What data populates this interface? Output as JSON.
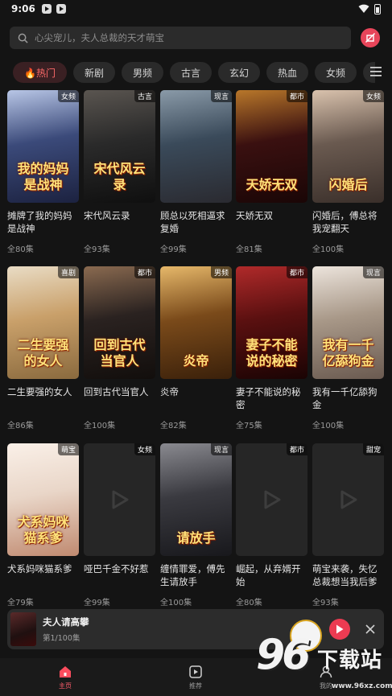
{
  "status_bar": {
    "time": "9:06"
  },
  "search": {
    "placeholder": "心尖宠儿，夫人总裁的天才萌宝"
  },
  "tabs": [
    {
      "label": "🔥热门",
      "active": true
    },
    {
      "label": "新剧"
    },
    {
      "label": "男频"
    },
    {
      "label": "古言"
    },
    {
      "label": "玄幻"
    },
    {
      "label": "热血"
    },
    {
      "label": "女频"
    },
    {
      "label": "都"
    }
  ],
  "dramas": [
    {
      "title": "摊牌了我的妈妈是战神",
      "episodes": "全80集",
      "tag": "女频",
      "poster_text": "我的妈妈是战神",
      "colors": [
        "#3b4a7a",
        "#b8c6e6",
        "#1c2240"
      ]
    },
    {
      "title": "宋代风云录",
      "episodes": "全93集",
      "tag": "古言",
      "poster_text": "宋代风云录",
      "colors": [
        "#2a2a2a",
        "#5a5550",
        "#0f0f0f"
      ]
    },
    {
      "title": "顾总以死相逼求复婚",
      "episodes": "全99集",
      "tag": "现言",
      "poster_text": "",
      "colors": [
        "#3a4a5a",
        "#8a9aa8",
        "#2a2a30"
      ]
    },
    {
      "title": "天娇无双",
      "episodes": "全81集",
      "tag": "都市",
      "poster_text": "天娇无双",
      "colors": [
        "#3a1010",
        "#b8772a",
        "#1a0606"
      ]
    },
    {
      "title": "闪婚后，傅总将我宠翻天",
      "episodes": "全100集",
      "tag": "女频",
      "poster_text": "闪婚后",
      "colors": [
        "#6a5a50",
        "#d9c2ad",
        "#3a2f2a"
      ]
    },
    {
      "title": "二生要强的女人",
      "episodes": "全86集",
      "tag": "喜剧",
      "poster_text": "二生要强的女人",
      "colors": [
        "#c9a06a",
        "#e9dcc5",
        "#8a6a3e"
      ]
    },
    {
      "title": "回到古代当官人",
      "episodes": "全100集",
      "tag": "都市",
      "poster_text": "回到古代当官人",
      "colors": [
        "#2a2220",
        "#8a6a50",
        "#120e0c"
      ]
    },
    {
      "title": "炎帝",
      "episodes": "全82集",
      "tag": "男频",
      "poster_text": "炎帝",
      "colors": [
        "#7a4a1a",
        "#e6b86a",
        "#3a200a"
      ]
    },
    {
      "title": "妻子不能说的秘密",
      "episodes": "全75集",
      "tag": "都市",
      "poster_text": "妻子不能说的秘密",
      "colors": [
        "#5a1010",
        "#b02a2a",
        "#1a0404"
      ]
    },
    {
      "title": "我有一千亿舔狗金",
      "episodes": "全100集",
      "tag": "现言",
      "poster_text": "我有一千亿舔狗金",
      "colors": [
        "#a89888",
        "#ece4dc",
        "#6a5a50"
      ]
    },
    {
      "title": "犬系妈咪猫系爹",
      "episodes": "全79集",
      "tag": "萌宝",
      "poster_text": "犬系妈咪猫系爹",
      "colors": [
        "#e9d6c8",
        "#faf0e8",
        "#c08a70"
      ]
    },
    {
      "title": "哑巴千金不好惹",
      "episodes": "全99集",
      "tag": "女频",
      "poster_text": "",
      "placeholder": true
    },
    {
      "title": "缠情罪爱，傅先生请放手",
      "episodes": "全100集",
      "tag": "现言",
      "poster_text": "请放手",
      "colors": [
        "#3a3a40",
        "#8a8a90",
        "#18181c"
      ]
    },
    {
      "title": "崛起，从弃婿开始",
      "episodes": "全80集",
      "tag": "都市",
      "poster_text": "",
      "placeholder": true
    },
    {
      "title": "萌宝来袭，失忆总裁想当我后爹",
      "episodes": "全93集",
      "tag": "甜宠",
      "poster_text": "",
      "placeholder": true
    }
  ],
  "mini_player": {
    "title": "夫人请高攀",
    "progress": "第1/100集"
  },
  "bottom_nav": [
    {
      "label": "主页",
      "active": true
    },
    {
      "label": "推荐"
    },
    {
      "label": "我的"
    }
  ],
  "watermark": {
    "brand": "96",
    "name": "下载站",
    "url": "www.96xz.com"
  }
}
